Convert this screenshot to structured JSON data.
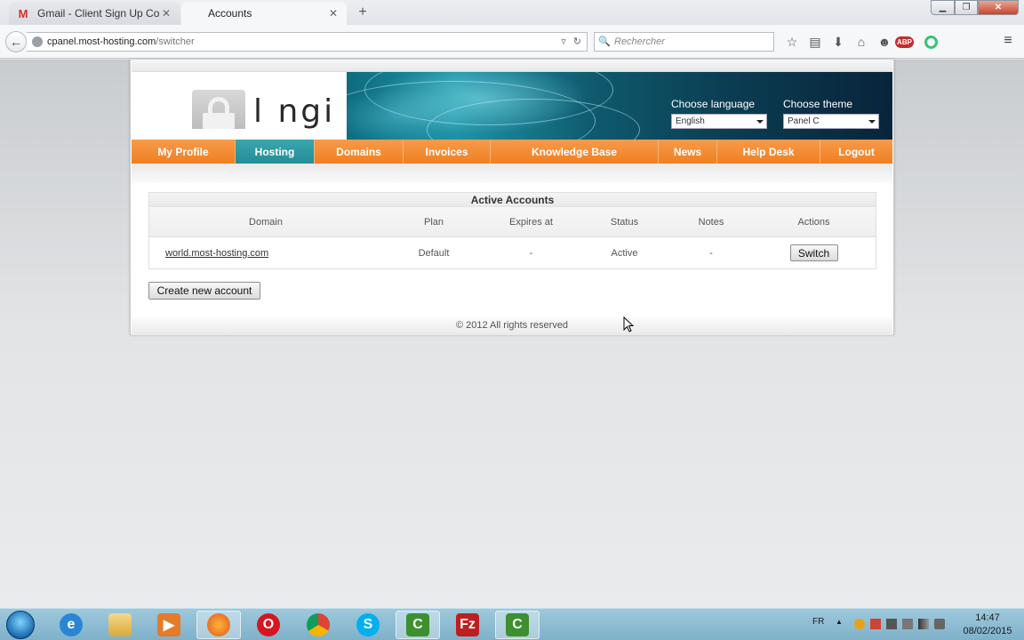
{
  "browser": {
    "tabs": [
      {
        "title": "Gmail - Client Sign Up Con...",
        "favicon": "gmail-icon",
        "active": false
      },
      {
        "title": "Accounts",
        "favicon": "blank-page-icon",
        "active": true
      }
    ],
    "url_host": "cpanel.most-hosting.com",
    "url_path": "/switcher",
    "search_placeholder": "Rechercher"
  },
  "site": {
    "logo_text": "l ngi",
    "choose_language_label": "Choose language",
    "language_selected": "English",
    "choose_theme_label": "Choose theme",
    "theme_selected": "Panel C",
    "menu": [
      {
        "label": "My Profile",
        "active": false
      },
      {
        "label": "Hosting",
        "active": true
      },
      {
        "label": "Domains",
        "active": false
      },
      {
        "label": "Invoices",
        "active": false
      },
      {
        "label": "Knowledge Base",
        "active": false
      },
      {
        "label": "News",
        "active": false
      },
      {
        "label": "Help Desk",
        "active": false
      },
      {
        "label": "Logout",
        "active": false
      }
    ]
  },
  "accounts_table": {
    "caption": "Active Accounts",
    "headers": {
      "domain": "Domain",
      "plan": "Plan",
      "expires": "Expires at",
      "status": "Status",
      "notes": "Notes",
      "actions": "Actions"
    },
    "rows": [
      {
        "domain": "world.most-hosting.com",
        "plan": "Default",
        "expires": "-",
        "status": "Active",
        "notes": "-",
        "action_label": "Switch"
      }
    ]
  },
  "create_account_label": "Create new account",
  "footer_text": "© 2012 All rights reserved",
  "taskbar": {
    "input_language": "FR",
    "time": "14:47",
    "date": "08/02/2015"
  },
  "colors": {
    "menu_orange": "#ef7f22",
    "menu_active_teal": "#2a949b",
    "banner_dark": "#0b3d52"
  }
}
